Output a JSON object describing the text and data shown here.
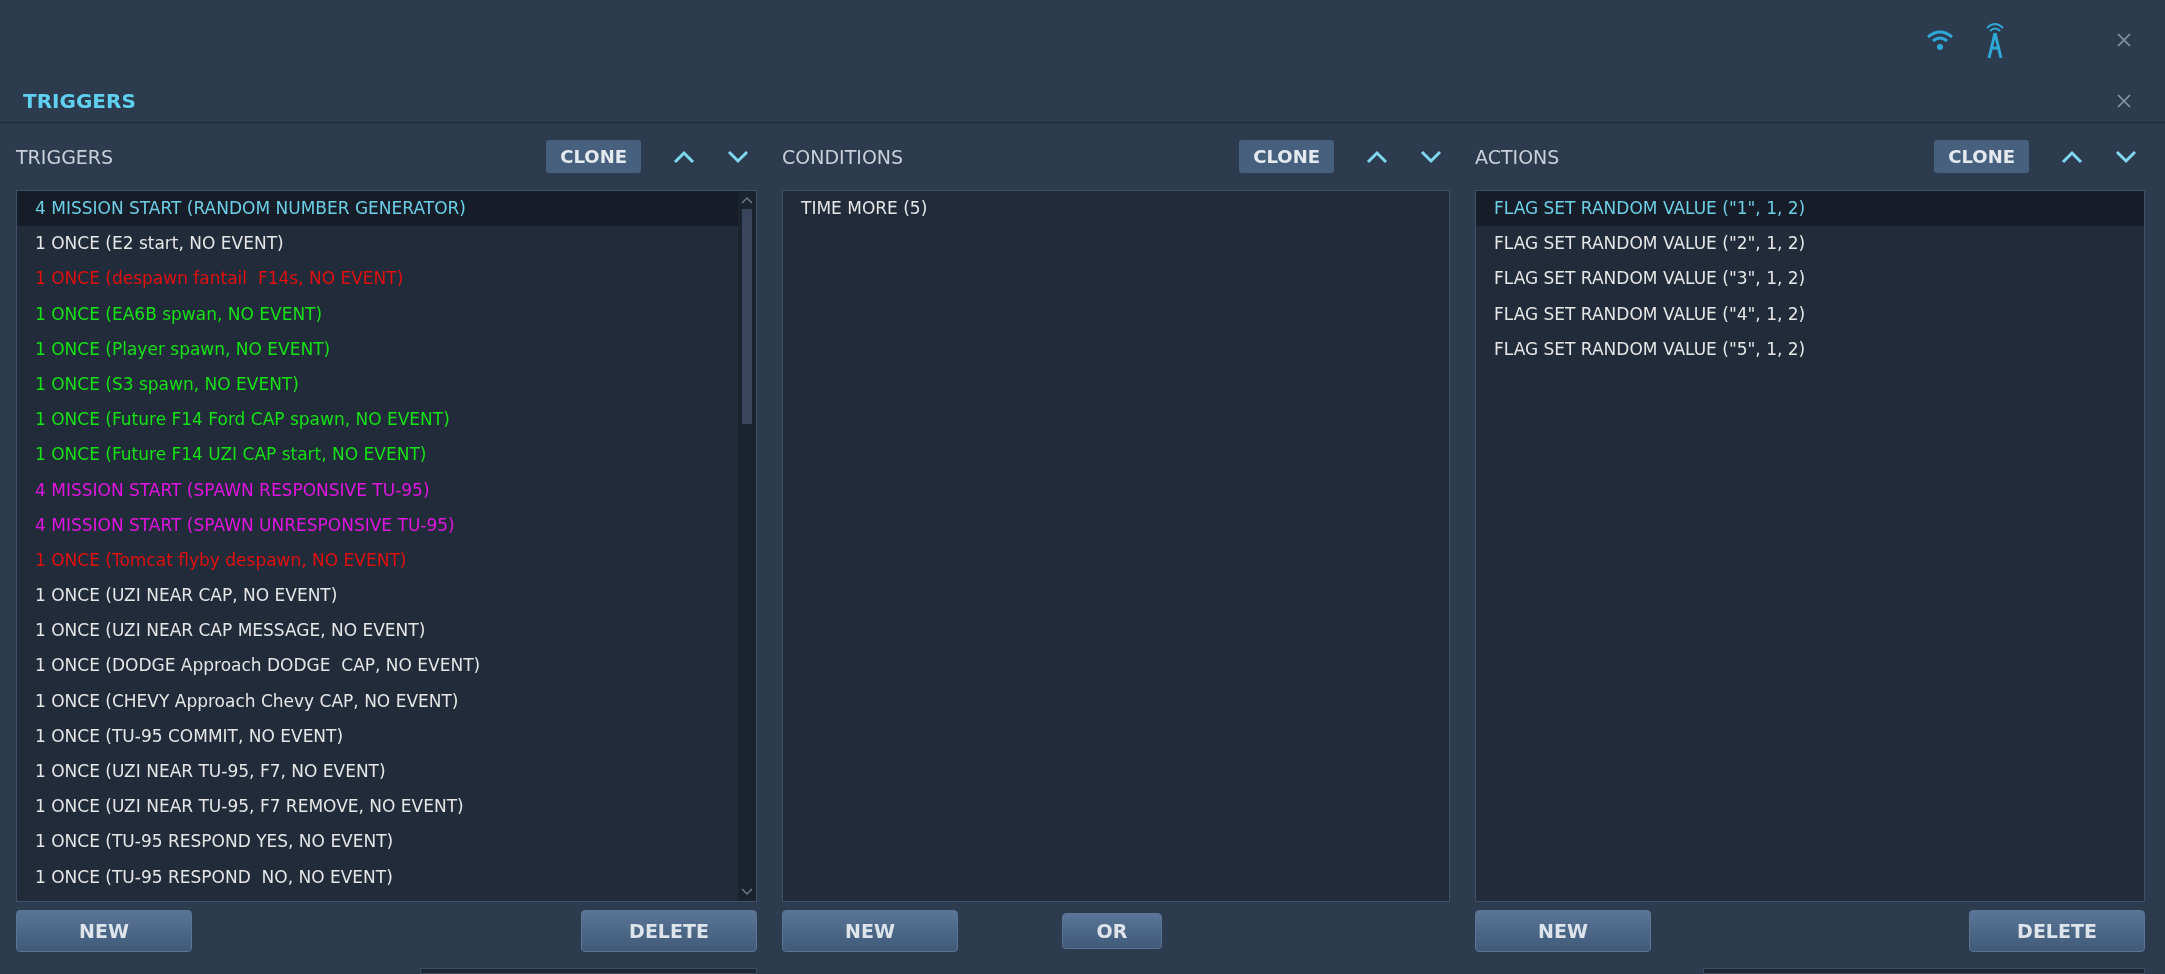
{
  "window": {
    "title": "TRIGGERS"
  },
  "panels": [
    {
      "title": "TRIGGERS",
      "clone": "CLONE",
      "scrollbar": true,
      "items": [
        {
          "text": "4 MISSION START (RANDOM NUMBER GENERATOR)",
          "selected": true
        },
        {
          "text": "1 ONCE (E2 start, NO EVENT)",
          "color": "#e6e6e6",
          "selected": false
        },
        {
          "text": "1 ONCE (despawn fantail  F14s, NO EVENT)",
          "color": "#e01010",
          "selected": false
        },
        {
          "text": "1 ONCE (EA6B spwan, NO EVENT)",
          "color": "#16e016",
          "selected": false
        },
        {
          "text": "1 ONCE (Player spawn, NO EVENT)",
          "color": "#16e016",
          "selected": false
        },
        {
          "text": "1 ONCE (S3 spawn, NO EVENT)",
          "color": "#16e016",
          "selected": false
        },
        {
          "text": "1 ONCE (Future F14 Ford CAP spawn, NO EVENT)",
          "color": "#16e016",
          "selected": false
        },
        {
          "text": "1 ONCE (Future F14 UZI CAP start, NO EVENT)",
          "color": "#16e016",
          "selected": false
        },
        {
          "text": "4 MISSION START (SPAWN RESPONSIVE TU-95)",
          "color": "#e016e0",
          "selected": false
        },
        {
          "text": "4 MISSION START (SPAWN UNRESPONSIVE TU-95)",
          "color": "#e016e0",
          "selected": false
        },
        {
          "text": "1 ONCE (Tomcat flyby despawn, NO EVENT)",
          "color": "#e01010",
          "selected": false
        },
        {
          "text": "1 ONCE (UZI NEAR CAP, NO EVENT)",
          "color": "#e6e6e6",
          "selected": false
        },
        {
          "text": "1 ONCE (UZI NEAR CAP MESSAGE, NO EVENT)",
          "color": "#e6e6e6",
          "selected": false
        },
        {
          "text": "1 ONCE (DODGE Approach DODGE  CAP, NO EVENT)",
          "color": "#e6e6e6",
          "selected": false
        },
        {
          "text": "1 ONCE (CHEVY Approach Chevy CAP, NO EVENT)",
          "color": "#e6e6e6",
          "selected": false
        },
        {
          "text": "1 ONCE (TU-95 COMMIT, NO EVENT)",
          "color": "#e6e6e6",
          "selected": false
        },
        {
          "text": "1 ONCE (UZI NEAR TU-95, F7, NO EVENT)",
          "color": "#e6e6e6",
          "selected": false
        },
        {
          "text": "1 ONCE (UZI NEAR TU-95, F7 REMOVE, NO EVENT)",
          "color": "#e6e6e6",
          "selected": false
        },
        {
          "text": "1 ONCE (TU-95 RESPOND YES, NO EVENT)",
          "color": "#e6e6e6",
          "selected": false
        },
        {
          "text": "1 ONCE (TU-95 RESPOND  NO, NO EVENT)",
          "color": "#e6e6e6",
          "selected": false
        }
      ],
      "buttons": [
        {
          "label": "NEW",
          "kind": "big"
        },
        {
          "label": "DELETE",
          "kind": "big"
        }
      ],
      "below_field": true
    },
    {
      "title": "CONDITIONS",
      "clone": "CLONE",
      "scrollbar": false,
      "items": [
        {
          "text": "TIME MORE (5)",
          "color": "#e6e6e6",
          "selected": false
        }
      ],
      "buttons": [
        {
          "label": "NEW",
          "kind": "big"
        },
        {
          "label": "OR",
          "kind": "small"
        }
      ],
      "below_field": false
    },
    {
      "title": "ACTIONS",
      "clone": "CLONE",
      "scrollbar": false,
      "items": [
        {
          "text": "FLAG SET RANDOM VALUE (\"1\", 1, 2)",
          "selected": true
        },
        {
          "text": "FLAG SET RANDOM VALUE (\"2\", 1, 2)",
          "color": "#e6e6e6",
          "selected": false
        },
        {
          "text": "FLAG SET RANDOM VALUE (\"3\", 1, 2)",
          "color": "#e6e6e6",
          "selected": false
        },
        {
          "text": "FLAG SET RANDOM VALUE (\"4\", 1, 2)",
          "color": "#e6e6e6",
          "selected": false
        },
        {
          "text": "FLAG SET RANDOM VALUE (\"5\", 1, 2)",
          "color": "#e6e6e6",
          "selected": false
        }
      ],
      "buttons": [
        {
          "label": "NEW",
          "kind": "big"
        },
        {
          "label": "DELETE",
          "kind": "big"
        }
      ],
      "below_field": true
    }
  ]
}
